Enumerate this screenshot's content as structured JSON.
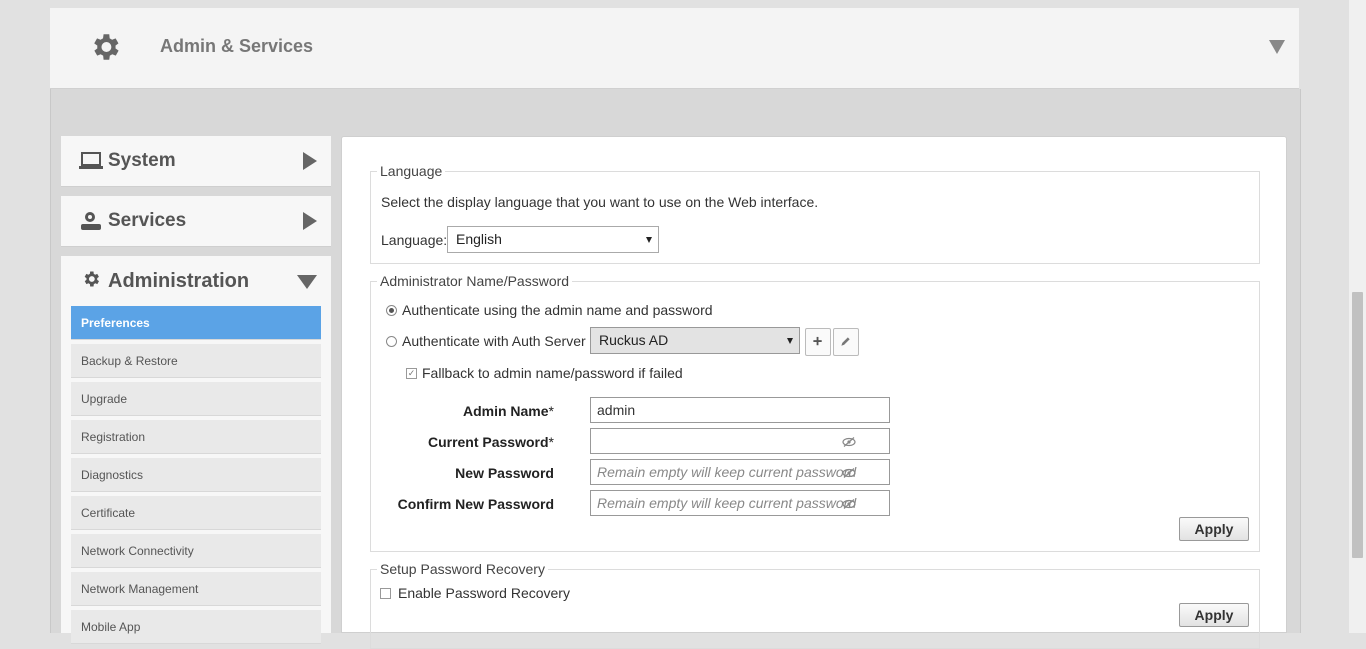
{
  "header": {
    "title": "Admin & Services",
    "icon": "gear-icon"
  },
  "nav": {
    "sections": [
      {
        "label": "System",
        "icon": "laptop-icon",
        "expanded": false
      },
      {
        "label": "Services",
        "icon": "services-icon",
        "expanded": false
      },
      {
        "label": "Administration",
        "icon": "gear-icon",
        "expanded": true
      }
    ],
    "items": [
      "Preferences",
      "Backup & Restore",
      "Upgrade",
      "Registration",
      "Diagnostics",
      "Certificate",
      "Network Connectivity",
      "Network Management",
      "Mobile App"
    ],
    "active_item": "Preferences",
    "active_color": "#5ba3e6"
  },
  "language": {
    "legend": "Language",
    "description": "Select the display language that you want to use on the Web interface.",
    "label": "Language:",
    "selected": "English"
  },
  "admin": {
    "legend": "Administrator Name/Password",
    "radio_local": "Authenticate using the admin name and password",
    "radio_server": "Authenticate with Auth Server",
    "auth_server_selected": "Ruckus AD",
    "fallback_label": "Fallback to admin name/password if failed",
    "admin_name_label": "Admin Name",
    "admin_name_value": "admin",
    "current_password_label": "Current Password",
    "new_password_label": "New Password",
    "confirm_password_label": "Confirm New Password",
    "required_mark": "*",
    "password_placeholder": "Remain empty will keep current password",
    "apply_label": "Apply"
  },
  "recovery": {
    "legend": "Setup Password Recovery",
    "enable_label": "Enable Password Recovery",
    "apply_label": "Apply"
  }
}
